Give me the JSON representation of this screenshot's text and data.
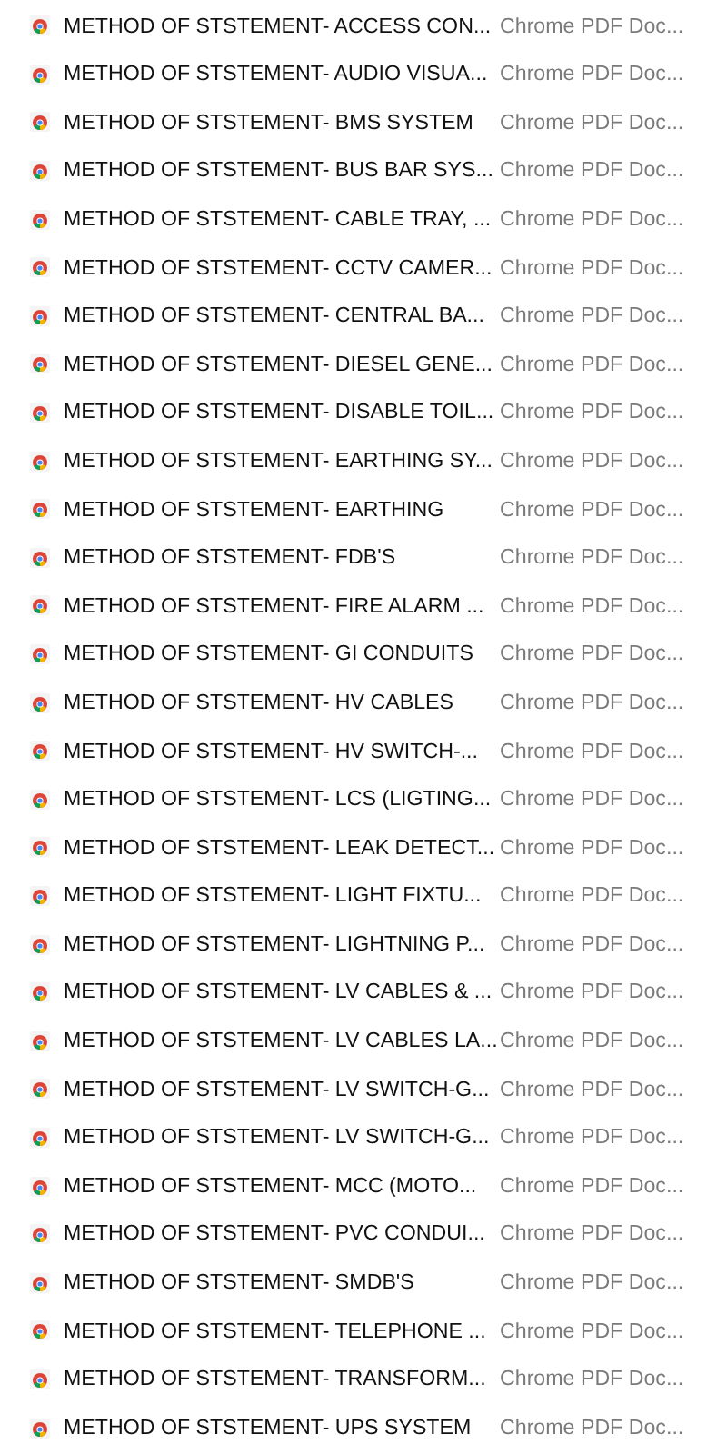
{
  "files": [
    {
      "name": "METHOD OF STSTEMENT- ACCESS CON...",
      "type": "Chrome PDF Doc..."
    },
    {
      "name": "METHOD OF STSTEMENT- AUDIO VISUA...",
      "type": "Chrome PDF Doc..."
    },
    {
      "name": "METHOD OF STSTEMENT- BMS SYSTEM",
      "type": "Chrome PDF Doc..."
    },
    {
      "name": "METHOD OF STSTEMENT- BUS BAR SYS...",
      "type": "Chrome PDF Doc..."
    },
    {
      "name": "METHOD OF STSTEMENT- CABLE TRAY, ...",
      "type": "Chrome PDF Doc..."
    },
    {
      "name": "METHOD OF STSTEMENT- CCTV CAMER...",
      "type": "Chrome PDF Doc..."
    },
    {
      "name": "METHOD OF STSTEMENT- CENTRAL BA...",
      "type": "Chrome PDF Doc..."
    },
    {
      "name": "METHOD OF STSTEMENT- DIESEL GENE...",
      "type": "Chrome PDF Doc..."
    },
    {
      "name": "METHOD OF STSTEMENT- DISABLE TOIL...",
      "type": "Chrome PDF Doc..."
    },
    {
      "name": "METHOD OF STSTEMENT- EARTHING SY...",
      "type": "Chrome PDF Doc..."
    },
    {
      "name": "METHOD OF STSTEMENT- EARTHING",
      "type": "Chrome PDF Doc..."
    },
    {
      "name": "METHOD OF STSTEMENT- FDB'S",
      "type": "Chrome PDF Doc..."
    },
    {
      "name": "METHOD OF STSTEMENT- FIRE ALARM ...",
      "type": "Chrome PDF Doc..."
    },
    {
      "name": "METHOD OF STSTEMENT- GI CONDUITS",
      "type": "Chrome PDF Doc..."
    },
    {
      "name": "METHOD OF STSTEMENT- HV CABLES",
      "type": "Chrome PDF Doc..."
    },
    {
      "name": "METHOD OF STSTEMENT- HV SWITCH-...",
      "type": "Chrome PDF Doc..."
    },
    {
      "name": "METHOD OF STSTEMENT- LCS (LIGTING...",
      "type": "Chrome PDF Doc..."
    },
    {
      "name": "METHOD OF STSTEMENT- LEAK DETECT...",
      "type": "Chrome PDF Doc..."
    },
    {
      "name": "METHOD OF STSTEMENT- LIGHT FIXTU...",
      "type": "Chrome PDF Doc..."
    },
    {
      "name": "METHOD OF STSTEMENT- LIGHTNING P...",
      "type": "Chrome PDF Doc..."
    },
    {
      "name": "METHOD OF STSTEMENT- LV CABLES & ...",
      "type": "Chrome PDF Doc..."
    },
    {
      "name": "METHOD OF STSTEMENT- LV CABLES LA...",
      "type": "Chrome PDF Doc..."
    },
    {
      "name": "METHOD OF STSTEMENT- LV SWITCH-G...",
      "type": "Chrome PDF Doc..."
    },
    {
      "name": "METHOD OF STSTEMENT- LV SWITCH-G...",
      "type": "Chrome PDF Doc..."
    },
    {
      "name": "METHOD OF STSTEMENT- MCC (MOTO...",
      "type": "Chrome PDF Doc..."
    },
    {
      "name": "METHOD OF STSTEMENT- PVC CONDUI...",
      "type": "Chrome PDF Doc..."
    },
    {
      "name": "METHOD OF STSTEMENT- SMDB'S",
      "type": "Chrome PDF Doc..."
    },
    {
      "name": "METHOD OF STSTEMENT- TELEPHONE ...",
      "type": "Chrome PDF Doc..."
    },
    {
      "name": "METHOD OF STSTEMENT- TRANSFORM...",
      "type": "Chrome PDF Doc..."
    },
    {
      "name": "METHOD OF STSTEMENT- UPS SYSTEM",
      "type": "Chrome PDF Doc..."
    }
  ]
}
